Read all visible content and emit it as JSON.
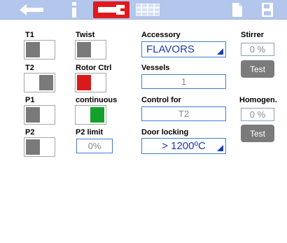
{
  "toolbar": {
    "back_icon": "arrow-left-icon",
    "info_icon": "info-icon",
    "tools_icon": "wrench-icon",
    "grid_icon": "grid-icon",
    "doc_icon": "document-icon",
    "save_icon": "save-icon",
    "active_color": "#e1191c"
  },
  "labels": {
    "t1": "T1",
    "twist": "Twist",
    "accessory": "Accessory",
    "stirrer": "Stirrer",
    "t2": "T2",
    "rotor_ctrl": "Rotor Ctrl",
    "vessels": "Vessels",
    "p1": "P1",
    "continuous": "continuous",
    "control_for": "Control for",
    "homogen": "Homogen.",
    "p2": "P2",
    "p2_limit": "P2 limit",
    "door_locking": "Door locking"
  },
  "toggles": {
    "t1": "off",
    "twist": "off",
    "t2": "on",
    "rotor_ctrl": "off",
    "p1": "off",
    "continuous": "on",
    "p2": "off"
  },
  "values": {
    "accessory": "FLAVORS",
    "vessels": "1",
    "control_for": "T2",
    "p2_limit": "0%",
    "door_locking": "> 1200ºC",
    "stirrer": "0 %",
    "homogen": "0 %"
  },
  "buttons": {
    "stirrer_test": "Test",
    "homogen_test": "Test"
  }
}
